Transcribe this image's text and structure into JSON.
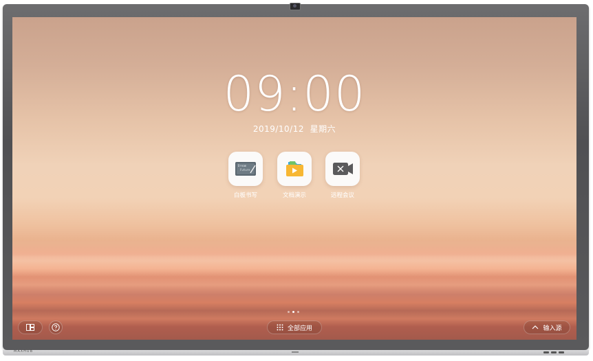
{
  "device": {
    "brand": "MAXHUB"
  },
  "home": {
    "time": "09:00",
    "date": "2019/10/12",
    "weekday": "星期六",
    "apps": [
      {
        "label": "白板书写",
        "icon": "whiteboard-icon"
      },
      {
        "label": "文档演示",
        "icon": "folder-play-icon"
      },
      {
        "label": "远程会议",
        "icon": "video-camera-icon"
      }
    ],
    "page_indicator": {
      "count": 3,
      "active": 2
    }
  },
  "bottom_bar": {
    "left_buttons": [
      "layout-grid-icon",
      "help-icon"
    ],
    "all_apps_label": "全部应用",
    "input_source_label": "输入源"
  },
  "colors": {
    "sky_top": "#caa28c",
    "sunset_band": "#ea9a78",
    "tile_bg": "#fbfaf9"
  }
}
